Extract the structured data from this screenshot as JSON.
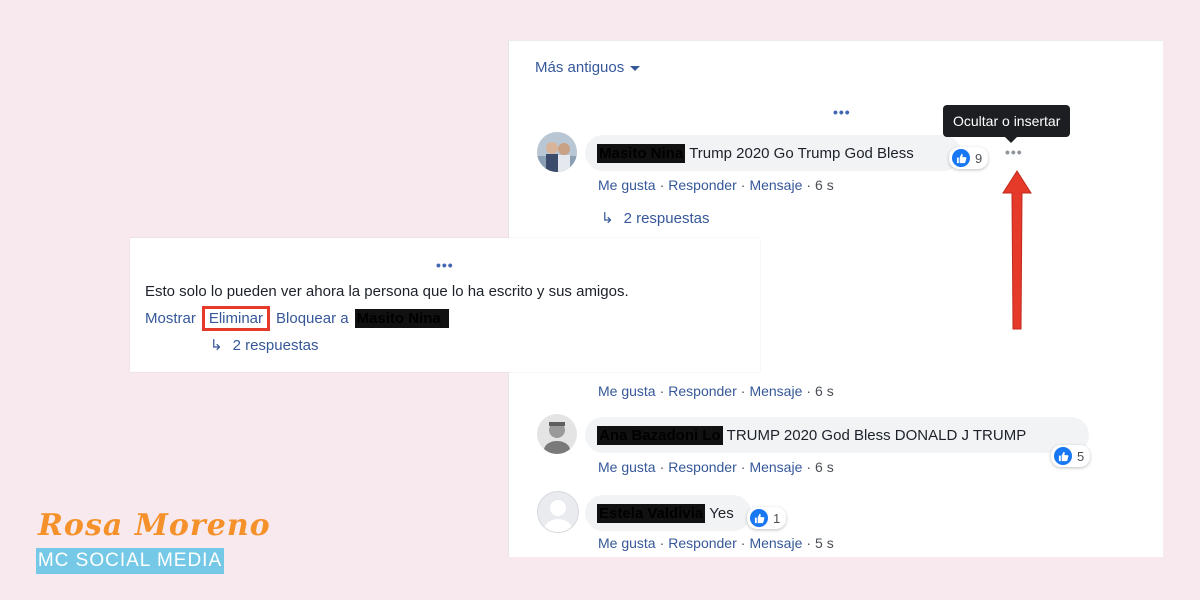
{
  "panel": {
    "sort_label": "Más antiguos",
    "more_dots": "•••",
    "tooltip": "Ocultar o insertar",
    "comments": [
      {
        "author": "Masito Nina",
        "text": "Trump 2020 Go Trump God Bless",
        "reactions": "9",
        "actions": [
          "Me gusta",
          "Responder",
          "Mensaje"
        ],
        "time": "6 s",
        "replies": "2 respuestas"
      },
      {
        "actions": [
          "Me gusta",
          "Responder",
          "Mensaje"
        ],
        "time": "6 s"
      },
      {
        "author": "Ana Bazadoni Lo",
        "text": "TRUMP 2020 God Bless DONALD J TRUMP",
        "reactions": "5",
        "actions": [
          "Me gusta",
          "Responder",
          "Mensaje"
        ],
        "time": "6 s"
      },
      {
        "author": "Estela Valdivia",
        "text": "Yes",
        "reactions": "1",
        "actions": [
          "Me gusta",
          "Responder",
          "Mensaje"
        ],
        "time": "5 s"
      }
    ]
  },
  "overlay": {
    "dots": "•••",
    "notice": "Esto solo lo pueden ver ahora la persona que lo ha escrito y sus amigos.",
    "show": "Mostrar",
    "delete": "Eliminar",
    "block": "Bloquear a",
    "blocked_name": "Masito Nina",
    "replies": "2 respuestas"
  },
  "branding": {
    "name": "Rosa Moreno",
    "subtitle": "MC SOCIAL MEDIA"
  },
  "colors": {
    "background": "#f8e9ef",
    "link": "#365899",
    "like": "#1877f2",
    "arrow": "#e53a2a",
    "logo_orange": "#f5912a",
    "logo_blue": "#76c9e6"
  }
}
